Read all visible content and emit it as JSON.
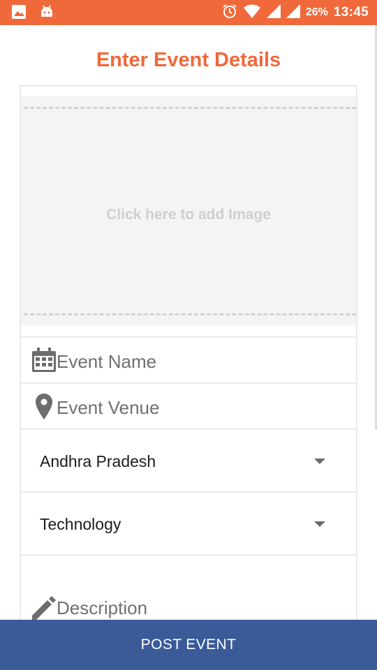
{
  "status_bar": {
    "left_icons": [
      "image-icon",
      "android-icon"
    ],
    "right_icons": [
      "alarm-icon",
      "wifi-icon",
      "signal-icon",
      "signal-icon"
    ],
    "battery": "26%",
    "time": "13:45",
    "color": "#f0693b"
  },
  "page": {
    "title": "Enter Event Details",
    "accent_color": "#f0693b"
  },
  "image_picker": {
    "label": "Click here to add Image"
  },
  "form": {
    "event_name_placeholder": "Event Name",
    "event_name_icon": "calendar-icon",
    "event_venue_placeholder": "Event Venue",
    "event_venue_icon": "location-pin-icon",
    "state_value": "Andhra Pradesh",
    "category_value": "Technology",
    "description_placeholder": "Description",
    "description_icon": "pencil-icon"
  },
  "actions": {
    "post_event_label": "POST EVENT",
    "button_color": "#3a5a98"
  }
}
